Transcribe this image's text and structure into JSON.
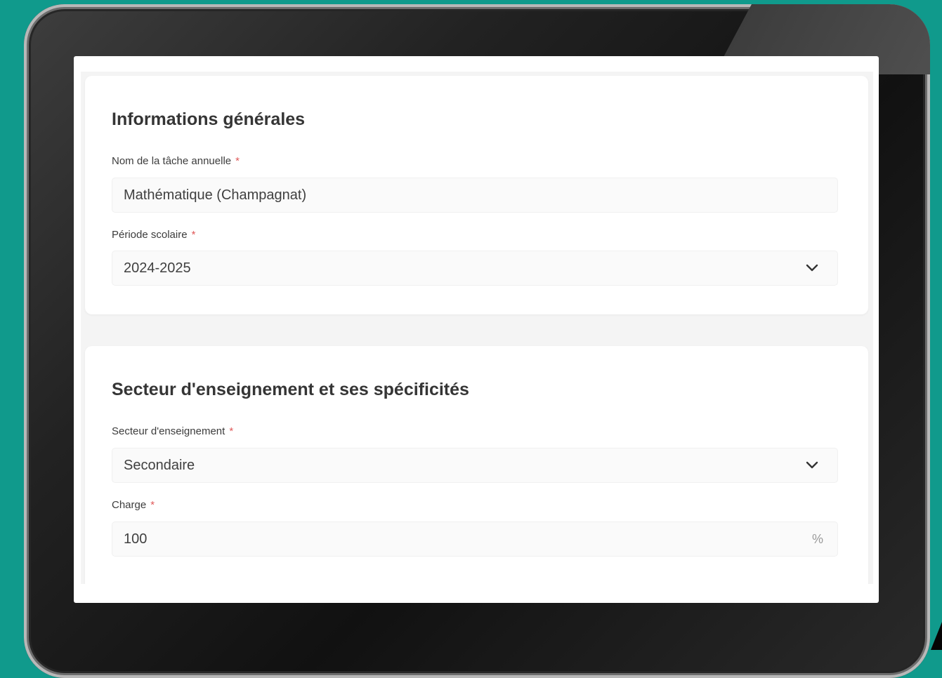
{
  "sections": {
    "general": {
      "title": "Informations générales",
      "task_name": {
        "label": "Nom de la tâche annuelle",
        "required_mark": "*",
        "value": "Mathématique (Champagnat)"
      },
      "school_period": {
        "label": "Période scolaire",
        "required_mark": "*",
        "value": "2024-2025",
        "icon": "chevron-down-icon"
      }
    },
    "sector": {
      "title": "Secteur d'enseignement et ses spécificités",
      "teaching_sector": {
        "label": "Secteur d'enseignement",
        "required_mark": "*",
        "value": "Secondaire",
        "icon": "chevron-down-icon"
      },
      "workload": {
        "label": "Charge",
        "required_mark": "*",
        "value": "100",
        "suffix": "%"
      }
    }
  },
  "colors": {
    "background": "#109a8c",
    "required": "#e05a5a",
    "text": "#353535"
  }
}
